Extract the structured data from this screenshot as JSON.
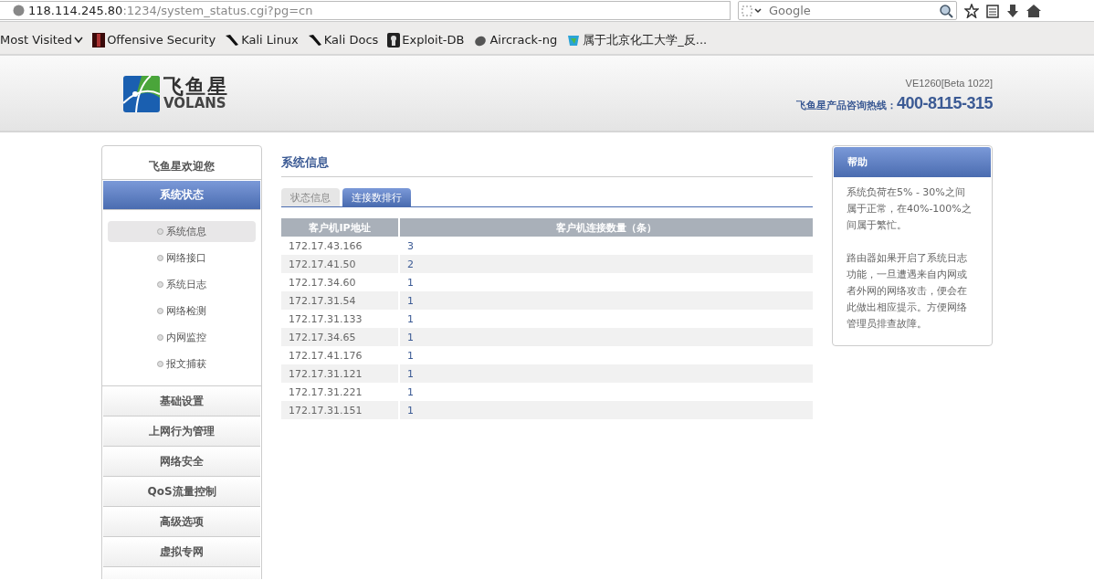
{
  "browser": {
    "url_host": "118.114.245.80",
    "url_rest": ":1234/system_status.cgi?pg=cn",
    "search_placeholder": "Google",
    "bookmarks": [
      "Most Visited",
      "Offensive Security",
      "Kali Linux",
      "Kali Docs",
      "Exploit-DB",
      "Aircrack-ng",
      "属于北京化工大学_反..."
    ]
  },
  "header": {
    "logo_cn": "飞鱼星",
    "logo_en": "VOLANS",
    "version": "VE1260[Beta 1022]",
    "hotline_label": "飞鱼星产品咨询热线：",
    "hotline": "400-8115-315"
  },
  "sidebar": {
    "welcome": "飞鱼星欢迎您",
    "sections": [
      {
        "label": "系统状态",
        "expanded": true,
        "items": [
          {
            "label": "系统信息",
            "selected": true
          },
          {
            "label": "网络接口",
            "selected": false
          },
          {
            "label": "系统日志",
            "selected": false
          },
          {
            "label": "网络检测",
            "selected": false
          },
          {
            "label": "内网监控",
            "selected": false
          },
          {
            "label": "报文捕获",
            "selected": false
          }
        ]
      },
      {
        "label": "基础设置",
        "expanded": false
      },
      {
        "label": "上网行为管理",
        "expanded": false
      },
      {
        "label": "网络安全",
        "expanded": false
      },
      {
        "label": "QoS流量控制",
        "expanded": false
      },
      {
        "label": "高级选项",
        "expanded": false
      },
      {
        "label": "虚拟专网",
        "expanded": false
      },
      {
        "expanded": false
      }
    ]
  },
  "main": {
    "title": "系统信息",
    "tabs": [
      {
        "label": "状态信息",
        "selected": false
      },
      {
        "label": "连接数排行",
        "selected": true
      }
    ],
    "table": {
      "columns": [
        "客户机IP地址",
        "客户机连接数量（条）"
      ],
      "rows": [
        {
          "ip": "172.17.43.166",
          "count": "3"
        },
        {
          "ip": "172.17.41.50",
          "count": "2"
        },
        {
          "ip": "172.17.34.60",
          "count": "1"
        },
        {
          "ip": "172.17.31.54",
          "count": "1"
        },
        {
          "ip": "172.17.31.133",
          "count": "1"
        },
        {
          "ip": "172.17.34.65",
          "count": "1"
        },
        {
          "ip": "172.17.41.176",
          "count": "1"
        },
        {
          "ip": "172.17.31.121",
          "count": "1"
        },
        {
          "ip": "172.17.31.221",
          "count": "1"
        },
        {
          "ip": "172.17.31.151",
          "count": "1"
        }
      ]
    }
  },
  "help": {
    "title": "帮助",
    "paragraphs": [
      "系统负荷在5% - 30%之间属于正常，在40%-100%之间属于繁忙。",
      "路由器如果开启了系统日志功能，一旦遭遇来自内网或者外网的网络攻击，便会在此做出相应提示。方便网络管理员排查故障。"
    ]
  }
}
